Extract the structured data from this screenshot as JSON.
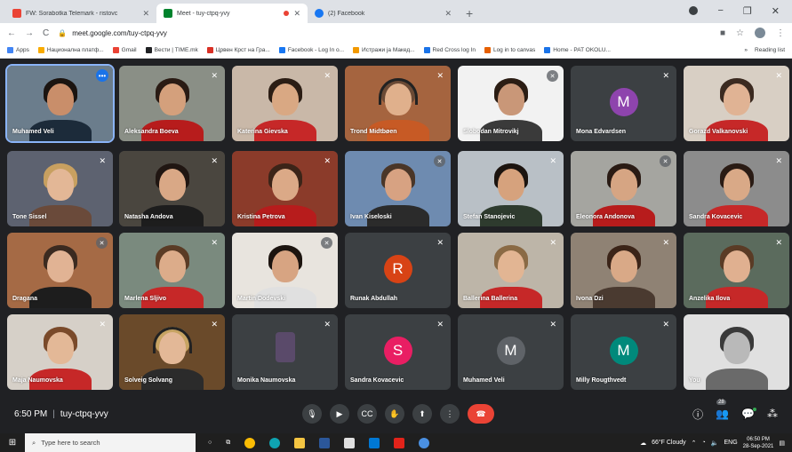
{
  "browser": {
    "tabs": [
      {
        "title": "FW: Sorabotka Telemark - ristovc",
        "color": "#ea4335",
        "active": false
      },
      {
        "title": "Meet - tuy-ctpq-yvy",
        "color": "#00832d",
        "active": true
      },
      {
        "title": "(2) Facebook",
        "color": "#1877f2",
        "active": false
      }
    ],
    "new_tab": "+",
    "url": "meet.google.com/tuy-ctpq-yvy",
    "bookmarks": [
      {
        "label": "Apps",
        "color": "#4285f4"
      },
      {
        "label": "Национална платф...",
        "color": "#f9ab00"
      },
      {
        "label": "Gmail",
        "color": "#ea4335",
        "prefix": "G"
      },
      {
        "label": "Вести | TIME.mk",
        "color": "#202124",
        "prefix": "T"
      },
      {
        "label": "Црвен Крст на Гра...",
        "color": "#d93025"
      },
      {
        "label": "Facebook - Log In o...",
        "color": "#1877f2"
      },
      {
        "label": "Истражи ја Макед...",
        "color": "#f29900"
      },
      {
        "label": "Red Cross log In",
        "color": "#1a73e8"
      },
      {
        "label": "Log in to canvas",
        "color": "#e66000"
      },
      {
        "label": "Home - PAT OKOLU...",
        "color": "#1a73e8"
      }
    ],
    "reading_list": "Reading list",
    "chevron": "»"
  },
  "participants": [
    {
      "name": "Muhamed Veli",
      "type": "video",
      "bg": "#6b7d8c",
      "shirt": "#1c2b3a",
      "skin": "#c98e6a",
      "hair": "#1b1410",
      "speaking": true
    },
    {
      "name": "Aleksandra Boeva",
      "type": "video",
      "bg": "#8a8f86",
      "shirt": "#b71c1c",
      "skin": "#d4a07c",
      "hair": "#2a1b14"
    },
    {
      "name": "Katerina Gievska",
      "type": "video",
      "bg": "#c9b8a8",
      "shirt": "#c62828",
      "skin": "#d9a883",
      "hair": "#2b1d14"
    },
    {
      "name": "Trond Midtbøen",
      "type": "video",
      "bg": "#a5643f",
      "shirt": "#c75a25",
      "skin": "#e0b08c",
      "hair": "#6b4a35",
      "headset": true
    },
    {
      "name": "Slobodan Mitrovikj",
      "type": "video",
      "bg": "#f2f2f2",
      "shirt": "#3a3a3a",
      "skin": "#c99778",
      "hair": "#2b1d14"
    },
    {
      "name": "Mona Edvardsen",
      "type": "letter",
      "letter": "M",
      "color": "#8e44ad"
    },
    {
      "name": "Gorazd Valkanovski",
      "type": "video",
      "bg": "#d8cfc4",
      "shirt": "#c62828",
      "skin": "#e0b394",
      "hair": "#3b2a20"
    },
    {
      "name": "Tone Sissel",
      "type": "video",
      "bg": "#5d6270",
      "shirt": "#6a4a3a",
      "skin": "#e3b796",
      "hair": "#c8a060"
    },
    {
      "name": "Natasha Andova",
      "type": "video",
      "bg": "#4a463f",
      "shirt": "#1d1d1d",
      "skin": "#d9a886",
      "hair": "#201612"
    },
    {
      "name": "Kristina Petrova",
      "type": "video",
      "bg": "#8b3b2a",
      "shirt": "#b71c1c",
      "skin": "#dba987",
      "hair": "#3b2418"
    },
    {
      "name": "Ivan Kiseloski",
      "type": "video",
      "bg": "#6e8bb0",
      "shirt": "#2b2b2b",
      "skin": "#d7a282",
      "hair": "#4a3628",
      "speakingMic": true
    },
    {
      "name": "Stefan Stanojevic",
      "type": "video",
      "bg": "#b9c0c6",
      "shirt": "#2e3b2e",
      "skin": "#d6a27d",
      "hair": "#1c140f"
    },
    {
      "name": "Eleonora Andonova",
      "type": "video",
      "bg": "#a5a5a0",
      "shirt": "#b71c1c",
      "skin": "#d6a583",
      "hair": "#2a1b14"
    },
    {
      "name": "Sandra Kovacevic",
      "type": "video",
      "bg": "#8c8c8c",
      "shirt": "#c62828",
      "skin": "#d9a987",
      "hair": "#2a1b14"
    },
    {
      "name": "Dragana",
      "type": "video",
      "bg": "#a56a45",
      "shirt": "#1d1d1d",
      "skin": "#e1b394",
      "hair": "#3b2a20"
    },
    {
      "name": "Marlena Sljivo",
      "type": "video",
      "bg": "#7a8a7e",
      "shirt": "#c62828",
      "skin": "#dcac8a",
      "hair": "#5a3b25"
    },
    {
      "name": "Martin Dodevski",
      "type": "video",
      "bg": "#e8e4de",
      "shirt": "#e0e0e0",
      "skin": "#d7a482",
      "hair": "#1c140f"
    },
    {
      "name": "Runak Abdullah",
      "type": "letter",
      "letter": "R",
      "color": "#d84315"
    },
    {
      "name": "Ballerina Ballerina",
      "type": "video",
      "bg": "#bdb5a8",
      "shirt": "#c62828",
      "skin": "#e2b593",
      "hair": "#8a6a45"
    },
    {
      "name": "Ivona Dzi",
      "type": "video",
      "bg": "#8f8274",
      "shirt": "#4a3a30",
      "skin": "#d9a987",
      "hair": "#3b2418"
    },
    {
      "name": "Anzelika Ilova",
      "type": "video",
      "bg": "#5b6b5d",
      "shirt": "#c62828",
      "skin": "#e0b090",
      "hair": "#5a3b25"
    },
    {
      "name": "Maja Naumovska",
      "type": "video",
      "bg": "#d6d0c8",
      "shirt": "#c62828",
      "skin": "#e3b897",
      "hair": "#7a4a2a"
    },
    {
      "name": "Solveig Solvang",
      "type": "video",
      "bg": "#6a4a2a",
      "shirt": "#2b2b2b",
      "skin": "#e3b897",
      "hair": "#c7a463",
      "headset": true
    },
    {
      "name": "Monika Naumovska",
      "type": "small",
      "bg": "#3c4043"
    },
    {
      "name": "Sandra Kovacevic",
      "type": "letter",
      "letter": "S",
      "color": "#e91e63"
    },
    {
      "name": "Muhamed Veli",
      "type": "letter",
      "letter": "M",
      "color": "#5f6368"
    },
    {
      "name": "Milly Rougthvedt",
      "type": "letter",
      "letter": "M",
      "color": "#00897b"
    },
    {
      "name": "You",
      "type": "video",
      "bg": "#e0e0e0",
      "shirt": "#6a6a6a",
      "skin": "#b9b9b9",
      "hair": "#3a3a3a",
      "self": true
    }
  ],
  "bottom": {
    "time": "6:50 PM",
    "divider": "|",
    "meeting_code": "tuy-ctpq-yvy",
    "participant_count": "28"
  },
  "taskbar": {
    "search_placeholder": "Type here to search",
    "weather": "66°F Cloudy",
    "lang": "ENG",
    "time": "06:50 PM",
    "date": "28-Sep-2021"
  }
}
